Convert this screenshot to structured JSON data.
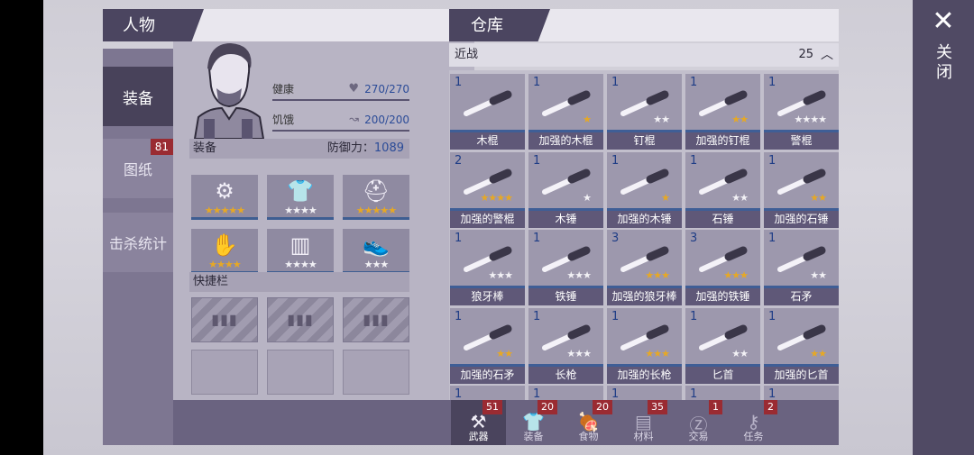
{
  "character": {
    "title": "人物",
    "side_tabs": [
      {
        "label": "装备",
        "active": true,
        "badge": ""
      },
      {
        "label": "图纸",
        "active": false,
        "badge": "81"
      },
      {
        "label": "击杀统计",
        "active": false,
        "badge": ""
      }
    ],
    "stats": [
      {
        "label": "健康",
        "icon": "heart-icon",
        "value": "270/270"
      },
      {
        "label": "饥饿",
        "icon": "stomach-icon",
        "value": "200/200"
      }
    ],
    "equipment_label": "装备",
    "defense_label": "防御力：",
    "defense_value": "1089",
    "equipment_slots": [
      {
        "icon": "saw-blade-icon",
        "glyph": "⚙",
        "stars": 5,
        "gold": true
      },
      {
        "icon": "jacket-icon",
        "glyph": "👕",
        "stars": 4,
        "gold": false
      },
      {
        "icon": "helmet-icon",
        "glyph": "⛑",
        "stars": 5,
        "gold": true
      },
      {
        "icon": "gloves-icon",
        "glyph": "✋",
        "stars": 4,
        "gold": true
      },
      {
        "icon": "pants-icon",
        "glyph": "▥",
        "stars": 4,
        "gold": false
      },
      {
        "icon": "shoes-icon",
        "glyph": "👟",
        "stars": 3,
        "gold": false
      }
    ],
    "quickbar_label": "快捷栏"
  },
  "storage": {
    "title": "仓库",
    "category": "近战",
    "count": "25",
    "items": [
      {
        "name": "木棍",
        "qty": "1",
        "stars": 0,
        "gold": false,
        "icon": "wood-stick-icon"
      },
      {
        "name": "加强的木棍",
        "qty": "1",
        "stars": 1,
        "gold": true,
        "icon": "reinforced-stick-icon"
      },
      {
        "name": "钉棍",
        "qty": "1",
        "stars": 2,
        "gold": false,
        "icon": "nail-bat-icon"
      },
      {
        "name": "加强的钉棍",
        "qty": "1",
        "stars": 2,
        "gold": true,
        "icon": "reinforced-nail-bat-icon"
      },
      {
        "name": "警棍",
        "qty": "1",
        "stars": 4,
        "gold": false,
        "icon": "baton-icon"
      },
      {
        "name": "加强的警棍",
        "qty": "2",
        "stars": 4,
        "gold": true,
        "icon": "reinforced-baton-icon"
      },
      {
        "name": "木锤",
        "qty": "1",
        "stars": 1,
        "gold": false,
        "icon": "wood-hammer-icon"
      },
      {
        "name": "加强的木锤",
        "qty": "1",
        "stars": 1,
        "gold": true,
        "icon": "reinforced-wood-hammer-icon"
      },
      {
        "name": "石锤",
        "qty": "1",
        "stars": 2,
        "gold": false,
        "icon": "stone-hammer-icon"
      },
      {
        "name": "加强的石锤",
        "qty": "1",
        "stars": 2,
        "gold": true,
        "icon": "reinforced-stone-hammer-icon"
      },
      {
        "name": "狼牙棒",
        "qty": "1",
        "stars": 3,
        "gold": false,
        "icon": "mace-icon"
      },
      {
        "name": "铁锤",
        "qty": "1",
        "stars": 3,
        "gold": false,
        "icon": "iron-hammer-icon"
      },
      {
        "name": "加强的狼牙棒",
        "qty": "3",
        "stars": 3,
        "gold": true,
        "icon": "reinforced-mace-icon"
      },
      {
        "name": "加强的铁锤",
        "qty": "3",
        "stars": 3,
        "gold": true,
        "icon": "reinforced-iron-hammer-icon"
      },
      {
        "name": "石矛",
        "qty": "1",
        "stars": 2,
        "gold": false,
        "icon": "stone-spear-icon"
      },
      {
        "name": "加强的石矛",
        "qty": "1",
        "stars": 2,
        "gold": true,
        "icon": "reinforced-stone-spear-icon"
      },
      {
        "name": "长枪",
        "qty": "1",
        "stars": 3,
        "gold": false,
        "icon": "long-spear-icon"
      },
      {
        "name": "加强的长枪",
        "qty": "1",
        "stars": 3,
        "gold": true,
        "icon": "reinforced-long-spear-icon"
      },
      {
        "name": "匕首",
        "qty": "1",
        "stars": 2,
        "gold": false,
        "icon": "dagger-icon"
      },
      {
        "name": "加强的匕首",
        "qty": "1",
        "stars": 2,
        "gold": true,
        "icon": "reinforced-dagger-icon"
      },
      {
        "name": "",
        "qty": "1",
        "stars": 0,
        "gold": false,
        "icon": "weapon-icon"
      },
      {
        "name": "",
        "qty": "1",
        "stars": 0,
        "gold": false,
        "icon": "weapon-icon"
      },
      {
        "name": "",
        "qty": "1",
        "stars": 0,
        "gold": false,
        "icon": "weapon-icon"
      },
      {
        "name": "",
        "qty": "1",
        "stars": 0,
        "gold": false,
        "icon": "weapon-icon"
      },
      {
        "name": "",
        "qty": "1",
        "stars": 0,
        "gold": false,
        "icon": "weapon-icon"
      }
    ],
    "bottom_tabs": [
      {
        "label": "武器",
        "badge": "51",
        "icon": "axe-icon",
        "glyph": "⚒",
        "active": true
      },
      {
        "label": "装备",
        "badge": "20",
        "icon": "shirt-icon",
        "glyph": "👕",
        "active": false
      },
      {
        "label": "食物",
        "badge": "20",
        "icon": "meat-icon",
        "glyph": "🍖",
        "active": false
      },
      {
        "label": "材料",
        "badge": "35",
        "icon": "planks-icon",
        "glyph": "▤",
        "active": false
      },
      {
        "label": "交易",
        "badge": "1",
        "icon": "coin-icon",
        "glyph": "Ⓩ",
        "active": false
      },
      {
        "label": "任务",
        "badge": "2",
        "icon": "key-icon",
        "glyph": "⚷",
        "active": false
      }
    ]
  },
  "close": {
    "label": "关闭",
    "glyph": "✕"
  }
}
